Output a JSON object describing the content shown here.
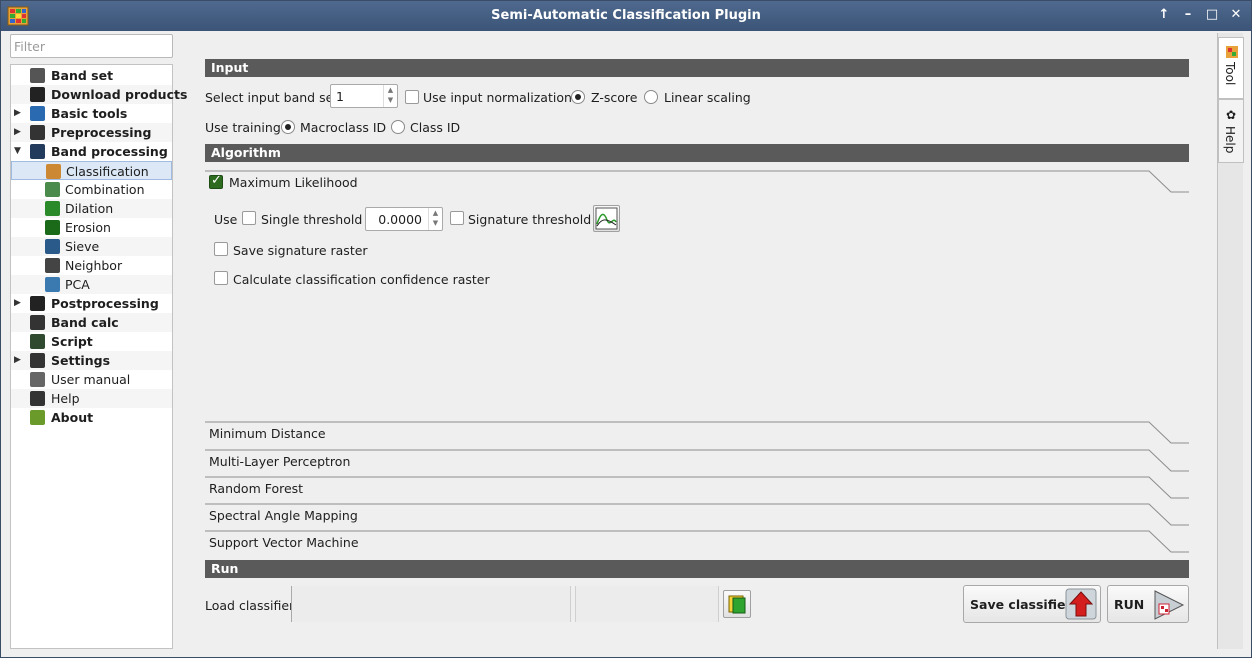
{
  "window": {
    "title": "Semi-Automatic Classification Plugin",
    "controls": [
      "↑",
      "–",
      "□",
      "✕"
    ]
  },
  "filter": {
    "placeholder": "Filter"
  },
  "tree": {
    "items": [
      {
        "label": "Band set",
        "icon": "band-set-icon",
        "level": 0,
        "bold": true,
        "arrow": ""
      },
      {
        "label": "Download products",
        "icon": "download-icon",
        "level": 0,
        "bold": true,
        "arrow": ""
      },
      {
        "label": "Basic tools",
        "icon": "basic-tools-icon",
        "level": 0,
        "bold": true,
        "arrow": "▶"
      },
      {
        "label": "Preprocessing",
        "icon": "preprocessing-icon",
        "level": 0,
        "bold": true,
        "arrow": "▶"
      },
      {
        "label": "Band processing",
        "icon": "band-processing-icon",
        "level": 0,
        "bold": true,
        "arrow": "▼"
      },
      {
        "label": "Classification",
        "icon": "classification-icon",
        "level": 1,
        "bold": false,
        "arrow": "",
        "selected": true
      },
      {
        "label": "Combination",
        "icon": "combination-icon",
        "level": 1,
        "bold": false,
        "arrow": ""
      },
      {
        "label": "Dilation",
        "icon": "dilation-icon",
        "level": 1,
        "bold": false,
        "arrow": ""
      },
      {
        "label": "Erosion",
        "icon": "erosion-icon",
        "level": 1,
        "bold": false,
        "arrow": ""
      },
      {
        "label": "Sieve",
        "icon": "sieve-icon",
        "level": 1,
        "bold": false,
        "arrow": ""
      },
      {
        "label": "Neighbor",
        "icon": "neighbor-icon",
        "level": 1,
        "bold": false,
        "arrow": ""
      },
      {
        "label": "PCA",
        "icon": "pca-icon",
        "level": 1,
        "bold": false,
        "arrow": ""
      },
      {
        "label": "Postprocessing",
        "icon": "postprocessing-icon",
        "level": 0,
        "bold": true,
        "arrow": "▶"
      },
      {
        "label": "Band calc",
        "icon": "band-calc-icon",
        "level": 0,
        "bold": true,
        "arrow": ""
      },
      {
        "label": "Script",
        "icon": "script-icon",
        "level": 0,
        "bold": true,
        "arrow": ""
      },
      {
        "label": "Settings",
        "icon": "settings-icon",
        "level": 0,
        "bold": true,
        "arrow": "▶"
      },
      {
        "label": "User manual",
        "icon": "user-manual-icon",
        "level": 0,
        "bold": false,
        "arrow": ""
      },
      {
        "label": "Help",
        "icon": "help-icon",
        "level": 0,
        "bold": false,
        "arrow": ""
      },
      {
        "label": "About",
        "icon": "about-icon",
        "level": 0,
        "bold": true,
        "arrow": ""
      }
    ]
  },
  "side_tabs": {
    "tool": "Tool",
    "help": "Help"
  },
  "input": {
    "header": "Input",
    "band_set_label": "Select input band set",
    "band_set_value": "1",
    "use_normalization": "Use input normalization",
    "zscore": "Z-score",
    "linear": "Linear scaling",
    "use_training": "Use training",
    "macroclass": "Macroclass ID",
    "classid": "Class ID"
  },
  "algorithm": {
    "header": "Algorithm",
    "max_likelihood": "Maximum Likelihood",
    "use": "Use",
    "single_threshold": "Single threshold",
    "threshold_value": "0.0000",
    "signature_threshold": "Signature threshold",
    "save_signature": "Save signature raster",
    "confidence": "Calculate classification confidence raster",
    "others": [
      "Minimum Distance",
      "Multi-Layer Perceptron",
      "Random Forest",
      "Spectral Angle Mapping",
      "Support Vector Machine"
    ]
  },
  "run": {
    "header": "Run",
    "load_classifier": "Load classifier",
    "save_classifier": "Save classifier",
    "run_label": "RUN"
  },
  "colors": {
    "section_bar": "#5a5a5a",
    "title_bar": "#4a6488",
    "selection": "#dce8f6"
  }
}
